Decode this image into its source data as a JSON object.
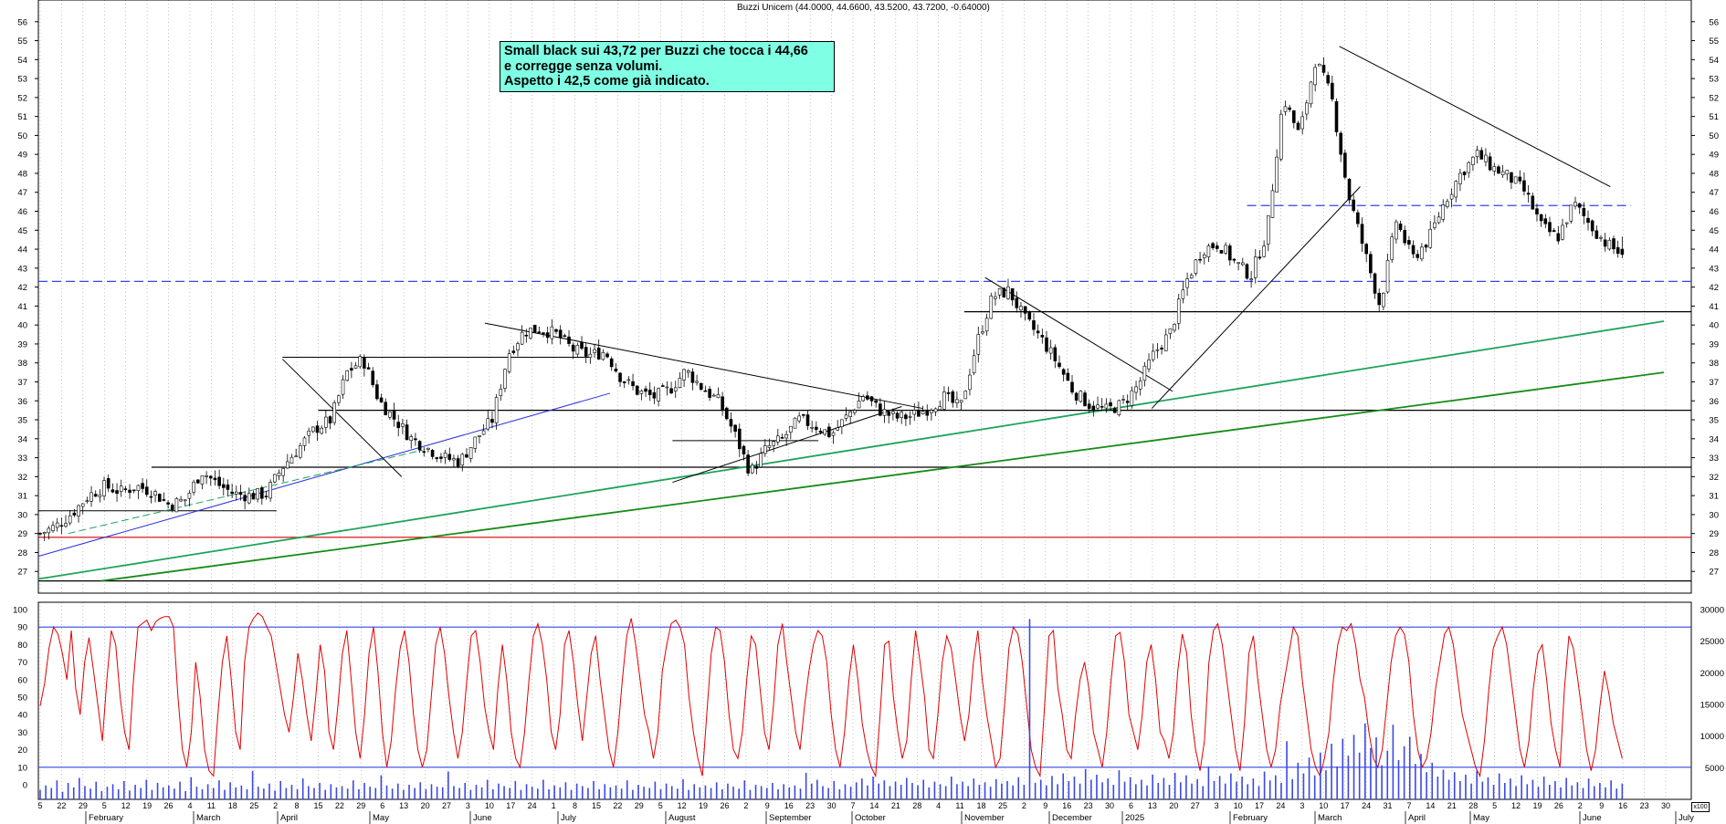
{
  "chart_data": [
    {
      "type": "candlestick",
      "title": "Buzzi Unicem (44.0000, 44.6600, 43.5200, 43.7200, -0.64000)",
      "ylim": [
        26,
        57
      ],
      "y_ticks": [
        27,
        28,
        29,
        30,
        31,
        32,
        33,
        34,
        35,
        36,
        37,
        38,
        39,
        40,
        41,
        42,
        43,
        44,
        45,
        46,
        47,
        48,
        49,
        50,
        51,
        52,
        53,
        54,
        55,
        56
      ],
      "x_day_labels": [
        "5",
        "22",
        "29",
        "5",
        "12",
        "19",
        "26",
        "4",
        "11",
        "18",
        "25",
        "2",
        "8",
        "15",
        "22",
        "29",
        "6",
        "13",
        "20",
        "27",
        "3",
        "10",
        "17",
        "24",
        "1",
        "8",
        "15",
        "22",
        "29",
        "5",
        "12",
        "19",
        "26",
        "2",
        "9",
        "16",
        "23",
        "30",
        "7",
        "14",
        "21",
        "28",
        "4",
        "11",
        "18",
        "25",
        "2",
        "9",
        "16",
        "23",
        "30",
        "6",
        "13",
        "20",
        "27",
        "3",
        "10",
        "17",
        "24",
        "3",
        "10",
        "17",
        "24",
        "31",
        "7",
        "14",
        "21",
        "28",
        "5",
        "12",
        "19",
        "26",
        "2",
        "9",
        "16",
        "23",
        "30"
      ],
      "x_month_labels": [
        "February",
        "March",
        "April",
        "May",
        "June",
        "July",
        "August",
        "September",
        "October",
        "November",
        "December",
        "2025",
        "February",
        "March",
        "April",
        "May",
        "June",
        "July"
      ],
      "close_path": [
        29,
        29.4,
        30.1,
        31,
        31.5,
        31.2,
        31.5,
        31.2,
        30.5,
        30.8,
        32.3,
        31.6,
        31.1,
        31,
        31.1,
        32.5,
        33.5,
        34.5,
        35,
        37.5,
        38.2,
        36,
        35,
        34,
        33.5,
        33,
        32.8,
        34,
        35,
        38.5,
        39.7,
        39.8,
        39.5,
        38.7,
        38.4,
        38.6,
        37.2,
        36.5,
        36.2,
        36.6,
        37.6,
        36.7,
        36,
        34.3,
        32.2,
        33.5,
        34,
        35,
        34.7,
        34.2,
        35.2,
        36.3,
        35.5,
        35.1,
        35.2,
        35.6,
        36.2,
        35.6,
        39,
        41.5,
        41.8,
        40.3,
        39.3,
        38,
        36.5,
        35.8,
        35.5,
        35.8,
        36.8,
        38.5,
        39.6,
        42.3,
        44,
        44.3,
        43.3,
        42.6,
        44.9,
        52,
        50,
        54,
        52,
        47,
        44,
        41,
        45.5,
        43.5,
        44.5,
        46.5,
        48,
        49,
        48.3,
        47.8,
        47,
        45.2,
        44.6,
        46.4,
        45.3,
        44.3,
        43.72
      ],
      "stats": {
        "open": 44.0,
        "high": 44.66,
        "low": 43.52,
        "close": 43.72,
        "change": -0.64
      },
      "horizontal_levels": [
        {
          "price": 42.3,
          "color": "#3346e8",
          "style": "dashed"
        },
        {
          "price": 46.3,
          "color": "#3346e8",
          "style": "dashed"
        },
        {
          "price": 40.7,
          "color": "#000000",
          "style": "solid"
        },
        {
          "price": 35.5,
          "color": "#000000",
          "style": "solid"
        },
        {
          "price": 32.5,
          "color": "#000000",
          "style": "solid"
        },
        {
          "price": 28.8,
          "color": "#d40000",
          "style": "solid"
        },
        {
          "price": 26.5,
          "color": "#000000",
          "style": "solid"
        }
      ],
      "trendlines": [
        {
          "from": [
            "2024-01-05",
            26.6
          ],
          "to": [
            "2025-07-04",
            40.2
          ],
          "color": "#1ea35a"
        },
        {
          "from": [
            "2024-01-26",
            26.5
          ],
          "to": [
            "2025-07-04",
            37.5
          ],
          "color": "#178c17"
        },
        {
          "from": [
            "2024-01-05",
            27.8
          ],
          "to": [
            "2024-07-15",
            36.4
          ],
          "color": "#2b2fdc"
        },
        {
          "from": [
            "2024-06-03",
            40.1
          ],
          "to": [
            "2024-10-28",
            35.6
          ],
          "color": "#000000"
        },
        {
          "from": [
            "2025-03-17",
            54.7
          ],
          "to": [
            "2025-06-16",
            47.3
          ],
          "color": "#000000"
        },
        {
          "from": [
            "2025-01-13",
            35.6
          ],
          "to": [
            "2025-03-24",
            47.3
          ],
          "color": "#000000"
        }
      ],
      "annotation": [
        "Small black sui 43,72 per Buzzi che tocca i 44,66",
        "e corregge senza volumi.",
        "Aspetto i 42,5 come già indicato."
      ]
    },
    {
      "type": "line",
      "name": "oscillator",
      "ylim": [
        0,
        100
      ],
      "y_ticks": [
        0,
        10,
        20,
        30,
        40,
        50,
        60,
        70,
        80,
        90,
        100
      ],
      "levels": [
        10,
        90
      ],
      "color": "#e00000",
      "values": [
        45,
        58,
        78,
        90,
        86,
        75,
        60,
        88,
        55,
        40,
        70,
        84,
        65,
        45,
        25,
        60,
        88,
        80,
        50,
        30,
        20,
        60,
        90,
        92,
        94,
        88,
        93,
        95,
        96,
        96,
        90,
        50,
        20,
        10,
        30,
        70,
        50,
        20,
        8,
        5,
        40,
        70,
        85,
        60,
        30,
        20,
        70,
        90,
        95,
        98,
        96,
        90,
        85,
        70,
        55,
        40,
        30,
        50,
        75,
        60,
        40,
        25,
        50,
        80,
        65,
        30,
        20,
        45,
        75,
        88,
        60,
        30,
        15,
        40,
        75,
        90,
        65,
        30,
        10,
        25,
        55,
        78,
        88,
        70,
        40,
        20,
        10,
        20,
        50,
        80,
        90,
        75,
        50,
        30,
        15,
        30,
        60,
        85,
        88,
        70,
        45,
        30,
        20,
        55,
        80,
        60,
        30,
        15,
        10,
        30,
        60,
        85,
        92,
        80,
        60,
        30,
        20,
        40,
        80,
        88,
        70,
        45,
        25,
        50,
        75,
        85,
        60,
        40,
        20,
        10,
        30,
        60,
        85,
        95,
        80,
        60,
        40,
        30,
        15,
        30,
        65,
        80,
        92,
        94,
        90,
        80,
        50,
        30,
        15,
        5,
        40,
        75,
        90,
        88,
        70,
        40,
        20,
        15,
        30,
        60,
        85,
        80,
        55,
        30,
        20,
        45,
        80,
        92,
        70,
        50,
        30,
        20,
        45,
        65,
        80,
        88,
        85,
        70,
        40,
        20,
        10,
        30,
        60,
        80,
        60,
        35,
        20,
        10,
        5,
        40,
        80,
        82,
        50,
        30,
        15,
        25,
        60,
        88,
        70,
        50,
        20,
        15,
        40,
        70,
        85,
        78,
        60,
        40,
        25,
        40,
        70,
        88,
        60,
        40,
        25,
        10,
        15,
        45,
        78,
        90,
        86,
        70,
        45,
        20,
        10,
        5,
        45,
        85,
        88,
        55,
        40,
        20,
        15,
        40,
        60,
        70,
        55,
        30,
        20,
        10,
        30,
        60,
        85,
        87,
        70,
        40,
        30,
        20,
        40,
        70,
        80,
        60,
        30,
        25,
        15,
        30,
        65,
        86,
        75,
        40,
        20,
        8,
        25,
        70,
        88,
        92,
        80,
        60,
        40,
        20,
        8,
        35,
        75,
        85,
        60,
        40,
        20,
        10,
        20,
        45,
        60,
        75,
        90,
        85,
        60,
        40,
        20,
        10,
        5,
        15,
        30,
        60,
        80,
        90,
        88,
        92,
        80,
        60,
        50,
        30,
        15,
        10,
        20,
        45,
        70,
        85,
        90,
        86,
        70,
        40,
        20,
        10,
        15,
        30,
        55,
        70,
        86,
        90,
        80,
        60,
        40,
        30,
        20,
        10,
        5,
        25,
        55,
        78,
        85,
        90,
        80,
        60,
        40,
        20,
        10,
        25,
        55,
        75,
        80,
        60,
        35,
        20,
        10,
        55,
        85,
        78,
        60,
        40,
        20,
        8,
        20,
        45,
        65,
        52,
        35,
        25,
        15
      ]
    },
    {
      "type": "bar",
      "name": "volume",
      "ylim": [
        0,
        30000
      ],
      "y_ticks": [
        5000,
        10000,
        15000,
        20000,
        25000,
        30000
      ],
      "color": "#3a48e6",
      "values": [
        1500,
        2200,
        1800,
        3000,
        1200,
        2600,
        1900,
        3400,
        2100,
        1700,
        2800,
        1300,
        2000,
        2400,
        1600,
        2900,
        1400,
        2300,
        1800,
        3100,
        1500,
        2600,
        1900,
        2200,
        1700,
        2800,
        1300,
        3500,
        2000,
        1600,
        2400,
        1800,
        3000,
        1500,
        2700,
        1900,
        2200,
        1600,
        4500,
        2000,
        1700,
        2500,
        1400,
        2900,
        1800,
        2300,
        1600,
        3300,
        2100,
        1800,
        2600,
        1500,
        2400,
        1900,
        2100,
        1700,
        3000,
        1600,
        2600,
        2000,
        1800,
        3800,
        2200,
        1700,
        2500,
        1500,
        2300,
        1800,
        2700,
        1600,
        2400,
        2000,
        1900,
        4400,
        2100,
        1800,
        2600,
        1500,
        2300,
        1900,
        3100,
        1600,
        2500,
        2100,
        1800,
        2900,
        1500,
        2400,
        2000,
        1700,
        3100,
        1600,
        2200,
        1900,
        2700,
        1500,
        2500,
        2100,
        1800,
        2900,
        1600,
        2400,
        1900,
        2200,
        1700,
        3000,
        1500,
        2300,
        2000,
        1800,
        2800,
        1600,
        2500,
        2100,
        1700,
        3200,
        1500,
        2400,
        1900,
        2200,
        1800,
        2700,
        1600,
        2500,
        2000,
        1700,
        3000,
        1500,
        2300,
        2100,
        1800,
        2600,
        1600,
        2400,
        1900,
        2200,
        1700,
        4200,
        2500,
        3100,
        2100,
        1800,
        2900,
        1600,
        2400,
        2000,
        2700,
        3300,
        2200,
        3600,
        2500,
        3000,
        2100,
        2800,
        2300,
        3400,
        2600,
        2200,
        3100,
        1900,
        2800,
        2400,
        2100,
        3600,
        2400,
        2800,
        2100,
        3300,
        2300,
        2700,
        2000,
        3200,
        2500,
        2900,
        2200,
        3500,
        2300,
        28500,
        2600,
        3100,
        2200,
        3700,
        2400,
        4100,
        2900,
        3600,
        2500,
        4800,
        3100,
        3900,
        2700,
        3300,
        2300,
        4600,
        2800,
        3500,
        2400,
        3100,
        2200,
        3900,
        2600,
        3400,
        2300,
        4200,
        2700,
        3800,
        2500,
        3200,
        2100,
        5200,
        2900,
        3700,
        2500,
        4100,
        2800,
        3600,
        2400,
        3300,
        2100,
        4400,
        3000,
        3800,
        2600,
        9200,
        3200,
        5800,
        4100,
        6600,
        3800,
        7400,
        4600,
        8800,
        5200,
        9600,
        6900,
        10200,
        7400,
        12000,
        8100,
        9800,
        5400,
        7700,
        11800,
        6200,
        8400,
        9900,
        5600,
        7200,
        4300,
        5800,
        3600,
        4700,
        3100,
        4300,
        2900,
        3900,
        2500,
        4600,
        2800,
        3500,
        2300,
        4100,
        2600,
        3300,
        2100,
        3800,
        2400,
        3100,
        2000,
        3600,
        2300,
        2900,
        1900,
        3400,
        2200,
        2700,
        1800,
        3300,
        2100,
        2600,
        1900,
        3000,
        1700,
        2500
      ]
    }
  ]
}
